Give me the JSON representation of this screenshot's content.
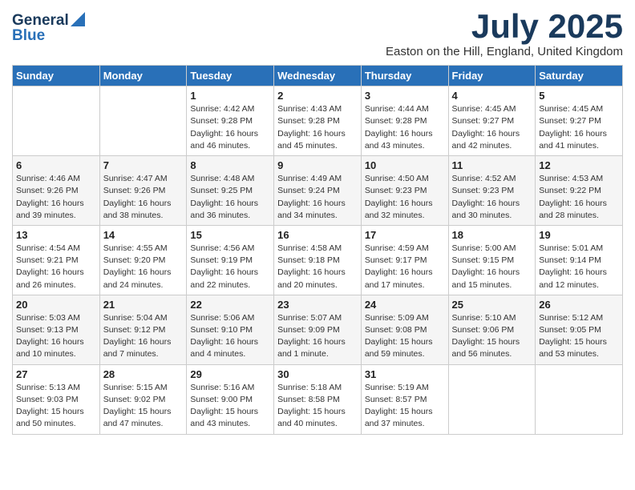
{
  "logo": {
    "general": "General",
    "blue": "Blue"
  },
  "title": "July 2025",
  "location": "Easton on the Hill, England, United Kingdom",
  "days_of_week": [
    "Sunday",
    "Monday",
    "Tuesday",
    "Wednesday",
    "Thursday",
    "Friday",
    "Saturday"
  ],
  "weeks": [
    [
      {
        "day": "",
        "info": ""
      },
      {
        "day": "",
        "info": ""
      },
      {
        "day": "1",
        "info": "Sunrise: 4:42 AM\nSunset: 9:28 PM\nDaylight: 16 hours\nand 46 minutes."
      },
      {
        "day": "2",
        "info": "Sunrise: 4:43 AM\nSunset: 9:28 PM\nDaylight: 16 hours\nand 45 minutes."
      },
      {
        "day": "3",
        "info": "Sunrise: 4:44 AM\nSunset: 9:28 PM\nDaylight: 16 hours\nand 43 minutes."
      },
      {
        "day": "4",
        "info": "Sunrise: 4:45 AM\nSunset: 9:27 PM\nDaylight: 16 hours\nand 42 minutes."
      },
      {
        "day": "5",
        "info": "Sunrise: 4:45 AM\nSunset: 9:27 PM\nDaylight: 16 hours\nand 41 minutes."
      }
    ],
    [
      {
        "day": "6",
        "info": "Sunrise: 4:46 AM\nSunset: 9:26 PM\nDaylight: 16 hours\nand 39 minutes."
      },
      {
        "day": "7",
        "info": "Sunrise: 4:47 AM\nSunset: 9:26 PM\nDaylight: 16 hours\nand 38 minutes."
      },
      {
        "day": "8",
        "info": "Sunrise: 4:48 AM\nSunset: 9:25 PM\nDaylight: 16 hours\nand 36 minutes."
      },
      {
        "day": "9",
        "info": "Sunrise: 4:49 AM\nSunset: 9:24 PM\nDaylight: 16 hours\nand 34 minutes."
      },
      {
        "day": "10",
        "info": "Sunrise: 4:50 AM\nSunset: 9:23 PM\nDaylight: 16 hours\nand 32 minutes."
      },
      {
        "day": "11",
        "info": "Sunrise: 4:52 AM\nSunset: 9:23 PM\nDaylight: 16 hours\nand 30 minutes."
      },
      {
        "day": "12",
        "info": "Sunrise: 4:53 AM\nSunset: 9:22 PM\nDaylight: 16 hours\nand 28 minutes."
      }
    ],
    [
      {
        "day": "13",
        "info": "Sunrise: 4:54 AM\nSunset: 9:21 PM\nDaylight: 16 hours\nand 26 minutes."
      },
      {
        "day": "14",
        "info": "Sunrise: 4:55 AM\nSunset: 9:20 PM\nDaylight: 16 hours\nand 24 minutes."
      },
      {
        "day": "15",
        "info": "Sunrise: 4:56 AM\nSunset: 9:19 PM\nDaylight: 16 hours\nand 22 minutes."
      },
      {
        "day": "16",
        "info": "Sunrise: 4:58 AM\nSunset: 9:18 PM\nDaylight: 16 hours\nand 20 minutes."
      },
      {
        "day": "17",
        "info": "Sunrise: 4:59 AM\nSunset: 9:17 PM\nDaylight: 16 hours\nand 17 minutes."
      },
      {
        "day": "18",
        "info": "Sunrise: 5:00 AM\nSunset: 9:15 PM\nDaylight: 16 hours\nand 15 minutes."
      },
      {
        "day": "19",
        "info": "Sunrise: 5:01 AM\nSunset: 9:14 PM\nDaylight: 16 hours\nand 12 minutes."
      }
    ],
    [
      {
        "day": "20",
        "info": "Sunrise: 5:03 AM\nSunset: 9:13 PM\nDaylight: 16 hours\nand 10 minutes."
      },
      {
        "day": "21",
        "info": "Sunrise: 5:04 AM\nSunset: 9:12 PM\nDaylight: 16 hours\nand 7 minutes."
      },
      {
        "day": "22",
        "info": "Sunrise: 5:06 AM\nSunset: 9:10 PM\nDaylight: 16 hours\nand 4 minutes."
      },
      {
        "day": "23",
        "info": "Sunrise: 5:07 AM\nSunset: 9:09 PM\nDaylight: 16 hours\nand 1 minute."
      },
      {
        "day": "24",
        "info": "Sunrise: 5:09 AM\nSunset: 9:08 PM\nDaylight: 15 hours\nand 59 minutes."
      },
      {
        "day": "25",
        "info": "Sunrise: 5:10 AM\nSunset: 9:06 PM\nDaylight: 15 hours\nand 56 minutes."
      },
      {
        "day": "26",
        "info": "Sunrise: 5:12 AM\nSunset: 9:05 PM\nDaylight: 15 hours\nand 53 minutes."
      }
    ],
    [
      {
        "day": "27",
        "info": "Sunrise: 5:13 AM\nSunset: 9:03 PM\nDaylight: 15 hours\nand 50 minutes."
      },
      {
        "day": "28",
        "info": "Sunrise: 5:15 AM\nSunset: 9:02 PM\nDaylight: 15 hours\nand 47 minutes."
      },
      {
        "day": "29",
        "info": "Sunrise: 5:16 AM\nSunset: 9:00 PM\nDaylight: 15 hours\nand 43 minutes."
      },
      {
        "day": "30",
        "info": "Sunrise: 5:18 AM\nSunset: 8:58 PM\nDaylight: 15 hours\nand 40 minutes."
      },
      {
        "day": "31",
        "info": "Sunrise: 5:19 AM\nSunset: 8:57 PM\nDaylight: 15 hours\nand 37 minutes."
      },
      {
        "day": "",
        "info": ""
      },
      {
        "day": "",
        "info": ""
      }
    ]
  ]
}
